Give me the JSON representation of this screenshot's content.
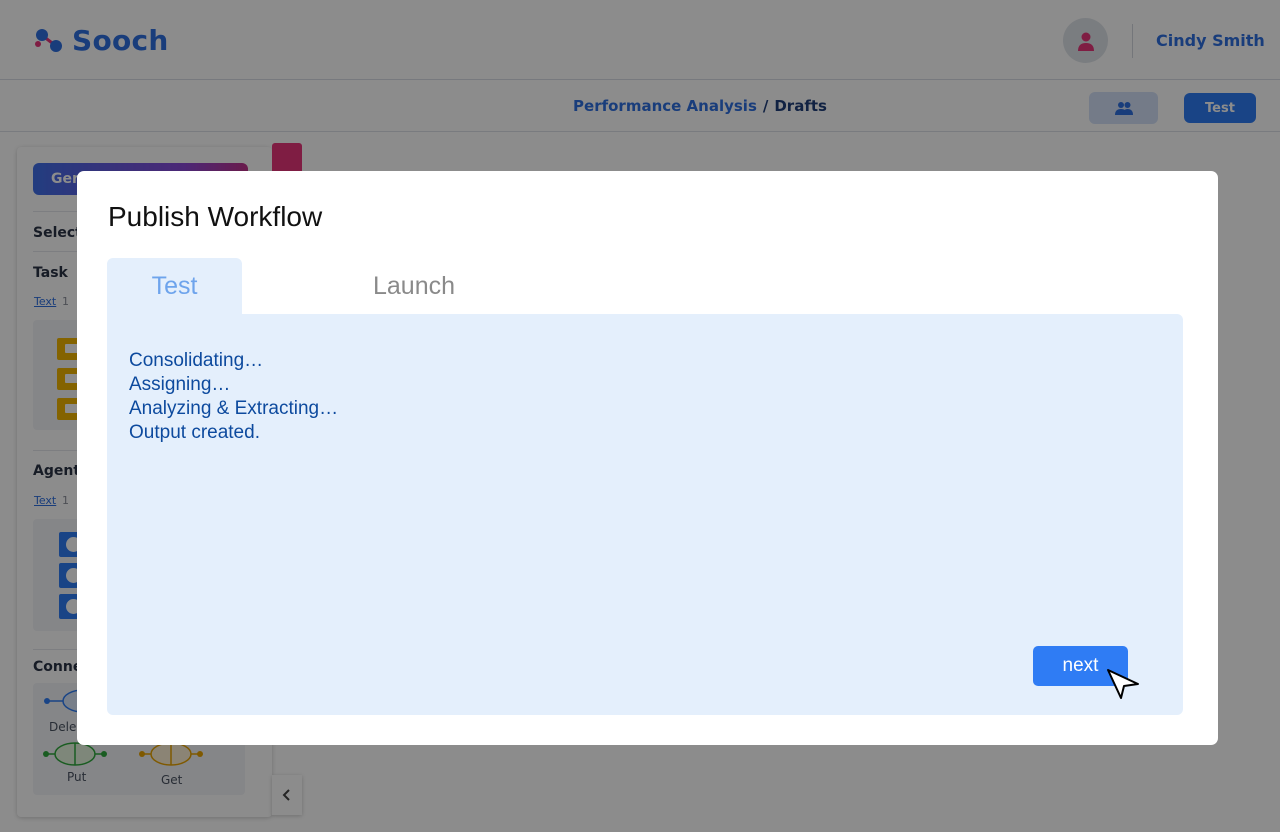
{
  "app": {
    "brand": "Sooch",
    "user_name": "Cindy Smith"
  },
  "breadcrumb": {
    "parent": "Performance Analysis",
    "separator": "/",
    "current": "Drafts"
  },
  "toolbar": {
    "team_icon": "people-icon",
    "test_label": "Test"
  },
  "sidebar": {
    "generate_label": "Ger",
    "select_heading": "Select",
    "task_heading": "Task",
    "task_link": "Text",
    "task_link_suffix": "1",
    "agent_heading": "Agent",
    "agent_link": "Text",
    "agent_link_suffix": "1",
    "connector_heading": "Conne",
    "connectors": [
      "Dele",
      "Put",
      "Get"
    ],
    "collapse_icon": "chevron-left-icon"
  },
  "modal": {
    "title": "Publish Workflow",
    "tabs": [
      {
        "label": "Test",
        "active": true
      },
      {
        "label": "Launch",
        "active": false
      }
    ],
    "log_lines": [
      "Consolidating…",
      "Assigning…",
      "Analyzing & Extracting…",
      "Output created."
    ],
    "next_label": "next"
  },
  "colors": {
    "accent": "#2f7cf4",
    "brand": "#2f6fe0",
    "panel_bg": "#e4effc",
    "log_text": "#0d4a9e",
    "task_color": "#f0b400"
  }
}
